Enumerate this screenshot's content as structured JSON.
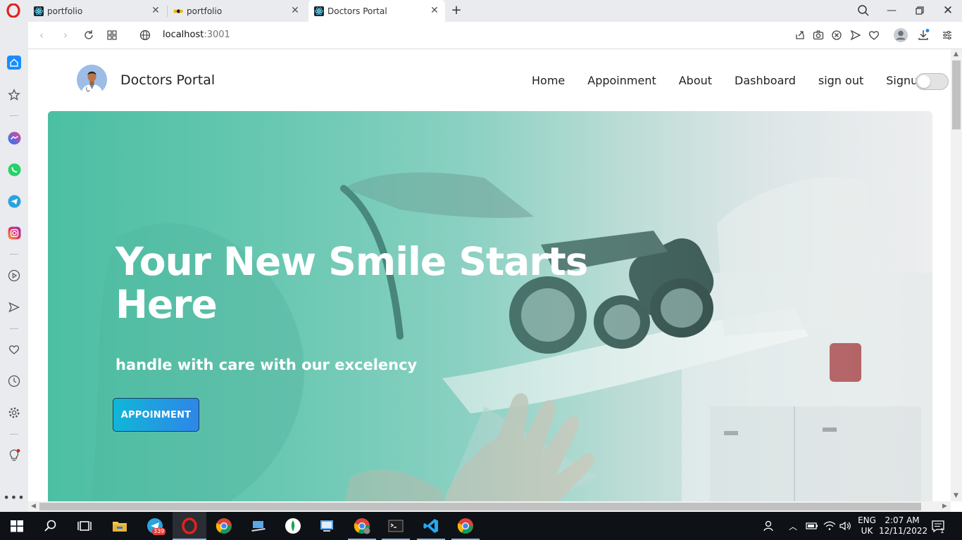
{
  "browser": {
    "tabs": [
      {
        "title": "portfolio",
        "active": false
      },
      {
        "title": "portfolio",
        "active": false
      },
      {
        "title": "Doctors Portal",
        "active": true
      }
    ],
    "url_host": "localhost",
    "url_port": ":3001"
  },
  "site": {
    "brand": "Doctors Portal",
    "nav": {
      "home": "Home",
      "appointment": "Appoinment",
      "about": "About",
      "dashboard": "Dashboard",
      "signout": "sign out",
      "signup": "Signup"
    },
    "theme_toggle_on": false,
    "hero": {
      "title": "Your New Smile Starts Here",
      "subtitle": "handle with care with our excelency",
      "button": "APPOINMENT"
    }
  },
  "sidebar": {
    "icons": [
      "home-icon",
      "star-icon",
      "messenger-icon",
      "whatsapp-icon",
      "telegram-icon",
      "instagram-icon",
      "player-icon",
      "send-icon",
      "heart-icon",
      "history-icon",
      "settings-icon",
      "lightbulb-icon",
      "more-icon"
    ]
  },
  "taskbar": {
    "telegram_badge": "339",
    "lang_top": "ENG",
    "lang_bottom": "UK",
    "time": "2:07 AM",
    "date": "12/11/2022",
    "notification_count": "1"
  },
  "colors": {
    "hero_teal": "#4cbfa3",
    "button_start": "#10b6d8",
    "button_end": "#2f86e8",
    "opera_red": "#e0221c"
  }
}
